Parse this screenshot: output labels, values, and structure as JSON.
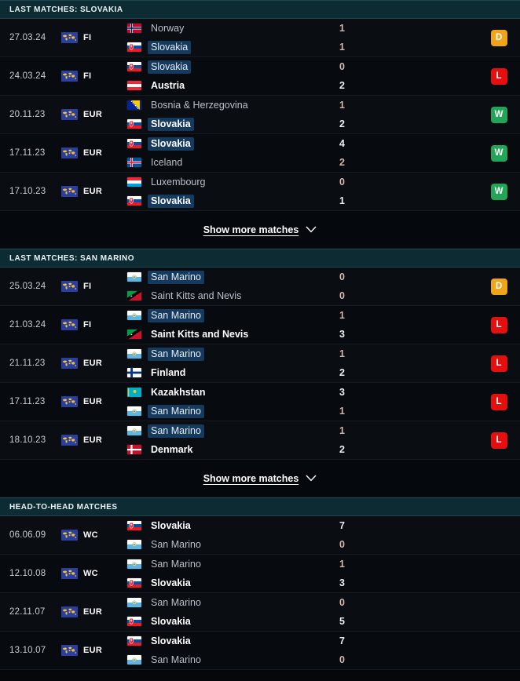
{
  "colors": {
    "win": "#23a559",
    "loss": "#e40f0f",
    "draw": "#f0a519",
    "highlight": "#163a5e",
    "header_bg": "#0c2b33",
    "page_bg": "#05070b"
  },
  "sections": [
    {
      "id": "last-matches-slovakia",
      "title": "LAST MATCHES: SLOVAKIA",
      "matches": [
        {
          "date": "27.03.24",
          "competition": "FI",
          "competition_icon": "world-map-icon",
          "home": {
            "team": "Norway",
            "flag": "norway",
            "score": "1",
            "winner": false,
            "highlight": false
          },
          "away": {
            "team": "Slovakia",
            "flag": "slovakia",
            "score": "1",
            "winner": false,
            "highlight": true
          },
          "result": "D"
        },
        {
          "date": "24.03.24",
          "competition": "FI",
          "competition_icon": "world-map-icon",
          "home": {
            "team": "Slovakia",
            "flag": "slovakia",
            "score": "0",
            "winner": false,
            "highlight": true
          },
          "away": {
            "team": "Austria",
            "flag": "austria",
            "score": "2",
            "winner": true,
            "highlight": false
          },
          "result": "L"
        },
        {
          "date": "20.11.23",
          "competition": "EUR",
          "competition_icon": "world-map-icon",
          "home": {
            "team": "Bosnia & Herzegovina",
            "flag": "bosnia",
            "score": "1",
            "winner": false,
            "highlight": false
          },
          "away": {
            "team": "Slovakia",
            "flag": "slovakia",
            "score": "2",
            "winner": true,
            "highlight": true
          },
          "result": "W"
        },
        {
          "date": "17.11.23",
          "competition": "EUR",
          "competition_icon": "world-map-icon",
          "home": {
            "team": "Slovakia",
            "flag": "slovakia",
            "score": "4",
            "winner": true,
            "highlight": true
          },
          "away": {
            "team": "Iceland",
            "flag": "iceland",
            "score": "2",
            "winner": false,
            "highlight": false
          },
          "result": "W"
        },
        {
          "date": "17.10.23",
          "competition": "EUR",
          "competition_icon": "world-map-icon",
          "home": {
            "team": "Luxembourg",
            "flag": "luxembourg",
            "score": "0",
            "winner": false,
            "highlight": false
          },
          "away": {
            "team": "Slovakia",
            "flag": "slovakia",
            "score": "1",
            "winner": true,
            "highlight": true
          },
          "result": "W"
        }
      ],
      "show_more": {
        "label": "Show more matches",
        "icon": "chevron-down-icon"
      }
    },
    {
      "id": "last-matches-san-marino",
      "title": "LAST MATCHES: SAN MARINO",
      "matches": [
        {
          "date": "25.03.24",
          "competition": "FI",
          "competition_icon": "world-map-icon",
          "home": {
            "team": "San Marino",
            "flag": "sanmarino",
            "score": "0",
            "winner": false,
            "highlight": true
          },
          "away": {
            "team": "Saint Kitts and Nevis",
            "flag": "stkitts",
            "score": "0",
            "winner": false,
            "highlight": false
          },
          "result": "D"
        },
        {
          "date": "21.03.24",
          "competition": "FI",
          "competition_icon": "world-map-icon",
          "home": {
            "team": "San Marino",
            "flag": "sanmarino",
            "score": "1",
            "winner": false,
            "highlight": true
          },
          "away": {
            "team": "Saint Kitts and Nevis",
            "flag": "stkitts",
            "score": "3",
            "winner": true,
            "highlight": false
          },
          "result": "L"
        },
        {
          "date": "21.11.23",
          "competition": "EUR",
          "competition_icon": "world-map-icon",
          "home": {
            "team": "San Marino",
            "flag": "sanmarino",
            "score": "1",
            "winner": false,
            "highlight": true
          },
          "away": {
            "team": "Finland",
            "flag": "finland",
            "score": "2",
            "winner": true,
            "highlight": false
          },
          "result": "L"
        },
        {
          "date": "17.11.23",
          "competition": "EUR",
          "competition_icon": "world-map-icon",
          "home": {
            "team": "Kazakhstan",
            "flag": "kazakhstan",
            "score": "3",
            "winner": true,
            "highlight": false
          },
          "away": {
            "team": "San Marino",
            "flag": "sanmarino",
            "score": "1",
            "winner": false,
            "highlight": true
          },
          "result": "L"
        },
        {
          "date": "18.10.23",
          "competition": "EUR",
          "competition_icon": "world-map-icon",
          "home": {
            "team": "San Marino",
            "flag": "sanmarino",
            "score": "1",
            "winner": false,
            "highlight": true
          },
          "away": {
            "team": "Denmark",
            "flag": "denmark",
            "score": "2",
            "winner": true,
            "highlight": false
          },
          "result": "L"
        }
      ],
      "show_more": {
        "label": "Show more matches",
        "icon": "chevron-down-icon"
      }
    },
    {
      "id": "head-to-head-matches",
      "title": "HEAD-TO-HEAD MATCHES",
      "matches": [
        {
          "date": "06.06.09",
          "competition": "WC",
          "competition_icon": "world-map-icon",
          "home": {
            "team": "Slovakia",
            "flag": "slovakia",
            "score": "7",
            "winner": true,
            "highlight": false
          },
          "away": {
            "team": "San Marino",
            "flag": "sanmarino",
            "score": "0",
            "winner": false,
            "highlight": false
          },
          "result": ""
        },
        {
          "date": "12.10.08",
          "competition": "WC",
          "competition_icon": "world-map-icon",
          "home": {
            "team": "San Marino",
            "flag": "sanmarino",
            "score": "1",
            "winner": false,
            "highlight": false
          },
          "away": {
            "team": "Slovakia",
            "flag": "slovakia",
            "score": "3",
            "winner": true,
            "highlight": false
          },
          "result": ""
        },
        {
          "date": "22.11.07",
          "competition": "EUR",
          "competition_icon": "world-map-icon",
          "home": {
            "team": "San Marino",
            "flag": "sanmarino",
            "score": "0",
            "winner": false,
            "highlight": false
          },
          "away": {
            "team": "Slovakia",
            "flag": "slovakia",
            "score": "5",
            "winner": true,
            "highlight": false
          },
          "result": ""
        },
        {
          "date": "13.10.07",
          "competition": "EUR",
          "competition_icon": "world-map-icon",
          "home": {
            "team": "Slovakia",
            "flag": "slovakia",
            "score": "7",
            "winner": true,
            "highlight": false
          },
          "away": {
            "team": "San Marino",
            "flag": "sanmarino",
            "score": "0",
            "winner": false,
            "highlight": false
          },
          "result": ""
        }
      ],
      "show_more": null
    }
  ]
}
